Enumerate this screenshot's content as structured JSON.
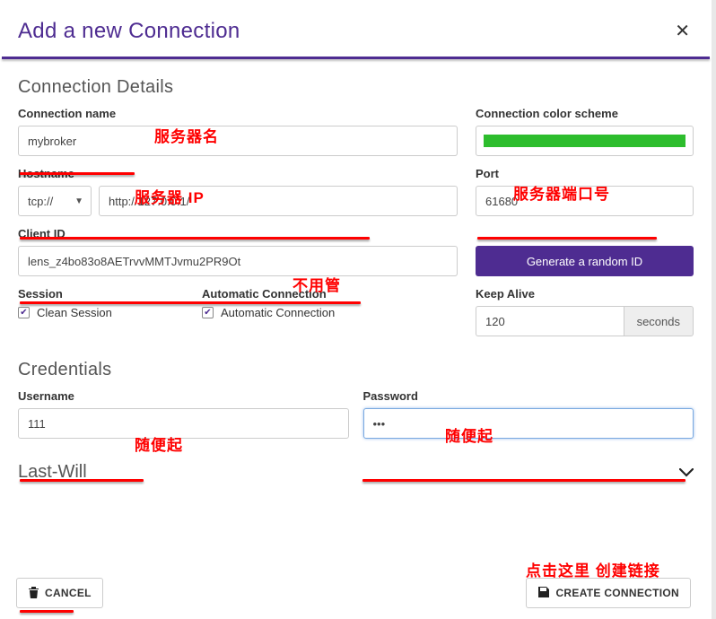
{
  "dialog": {
    "title": "Add a new Connection"
  },
  "sections": {
    "details": "Connection Details",
    "credentials": "Credentials",
    "lastwill": "Last-Will"
  },
  "labels": {
    "connection_name": "Connection name",
    "color_scheme": "Connection color scheme",
    "hostname": "Hostname",
    "port": "Port",
    "client_id": "Client ID",
    "session": "Session",
    "auto_conn": "Automatic Connection",
    "keep_alive": "Keep Alive",
    "username": "Username",
    "password": "Password"
  },
  "values": {
    "connection_name": "mybroker",
    "protocol": "tcp://",
    "hostname": "http://127.0.0.1/",
    "port": "61680",
    "client_id": "lens_z4bo83o8AETrvvMMTJvmu2PR9Ot",
    "clean_session_label": "Clean Session",
    "auto_conn_label": "Automatic Connection",
    "keep_alive": "120",
    "keep_alive_unit": "seconds",
    "username": "111",
    "password": "•••",
    "color_scheme": "#2dbd2d"
  },
  "buttons": {
    "generate_id": "Generate a random ID",
    "cancel": "CANCEL",
    "create": "CREATE CONNECTION"
  },
  "annotations": {
    "server_name": "服务器名",
    "server_ip": "服务器 IP",
    "server_port": "服务器端口号",
    "ignore": "不用管",
    "random1": "随便起",
    "random2": "随便起",
    "click_here": "点击这里 创建链接"
  }
}
